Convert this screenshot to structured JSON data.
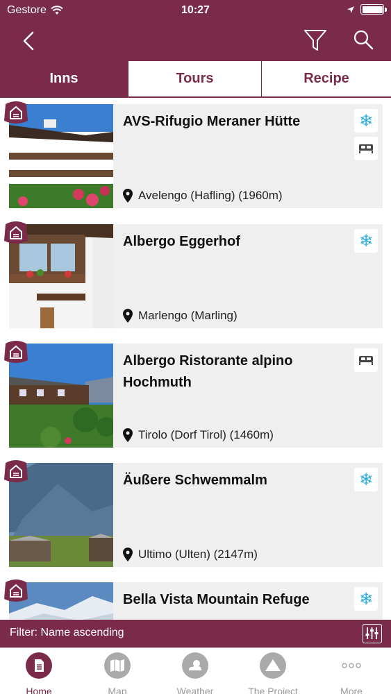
{
  "status_bar": {
    "carrier": "Gestore",
    "time": "10:27"
  },
  "tabs": [
    {
      "label": "Inns",
      "active": true
    },
    {
      "label": "Tours",
      "active": false
    },
    {
      "label": "Recipe",
      "active": false
    }
  ],
  "inns": [
    {
      "name": "AVS-Rifugio Meraner Hütte",
      "location": "Avelengo (Hafling) (1960m)",
      "features": [
        "snowflake-icon",
        "bed-icon"
      ]
    },
    {
      "name": "Albergo Eggerhof",
      "location": "Marlengo (Marling)",
      "features": [
        "snowflake-icon"
      ]
    },
    {
      "name": "Albergo Ristorante alpino Hochmuth",
      "location": "Tirolo (Dorf Tirol) (1460m)",
      "features": [
        "bed-icon"
      ]
    },
    {
      "name": "Äußere Schwemmalm",
      "location": "Ultimo (Ulten) (2147m)",
      "features": [
        "snowflake-icon"
      ]
    },
    {
      "name": "Bella Vista Mountain Refuge",
      "location": "",
      "features": [
        "snowflake-icon"
      ]
    }
  ],
  "filter_bar": {
    "text": "Filter: Name ascending"
  },
  "bottom_tabs": [
    {
      "label": "Home",
      "icon": "document-icon",
      "active": true
    },
    {
      "label": "Map",
      "icon": "map-icon",
      "active": false
    },
    {
      "label": "Weather",
      "icon": "weather-icon",
      "active": false
    },
    {
      "label": "The Project",
      "icon": "mountain-icon",
      "active": false
    },
    {
      "label": "More",
      "icon": "more-icon",
      "active": false
    }
  ],
  "colors": {
    "brand": "#7a2b4a",
    "snowflake": "#2eaee0",
    "inactive_tab": "#999999"
  }
}
